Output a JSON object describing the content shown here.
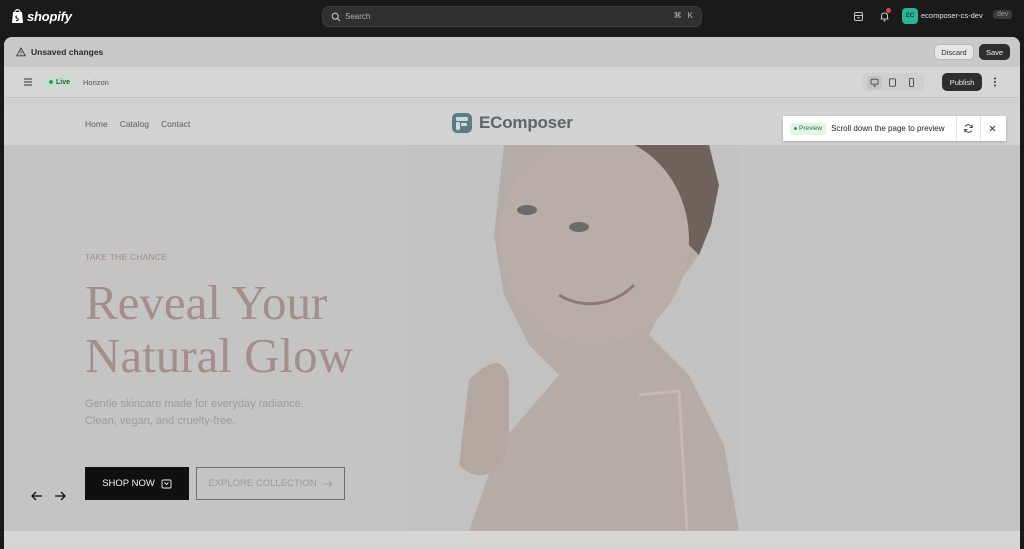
{
  "admin_bar": {
    "brand": "shopify",
    "search_placeholder": "Search",
    "shortcut": [
      "⌘",
      "K"
    ],
    "store_initials": "EC",
    "store_name": "ecomposer-cs-dev",
    "store_tag": "dev"
  },
  "unsaved_bar": {
    "label": "Unsaved changes",
    "discard": "Discard",
    "save": "Save"
  },
  "editor_toolbar": {
    "status": "Live",
    "theme": "Horizon",
    "publish": "Publish",
    "devices": [
      "desktop",
      "tablet",
      "mobile"
    ]
  },
  "site": {
    "nav": [
      "Home",
      "Catalog",
      "Contact"
    ],
    "logo": "EComposer",
    "hero": {
      "eyebrow": "TAKE THE CHANCE",
      "headline_line1": "Reveal Your",
      "headline_line2": "Natural Glow",
      "sub_line1": "Gentle skincare made for everyday radiance.",
      "sub_line2": "Clean, vegan, and cruelty-free.",
      "primary_cta": "SHOP NOW",
      "secondary_cta": "EXPLORE COLLECTION"
    }
  },
  "preview_toast": {
    "tag": "Preview",
    "message": "Scroll down the page to preview"
  },
  "colors": {
    "accent": "#2bb398",
    "headline": "#a48e8b",
    "dark": "#2e2e2e"
  }
}
